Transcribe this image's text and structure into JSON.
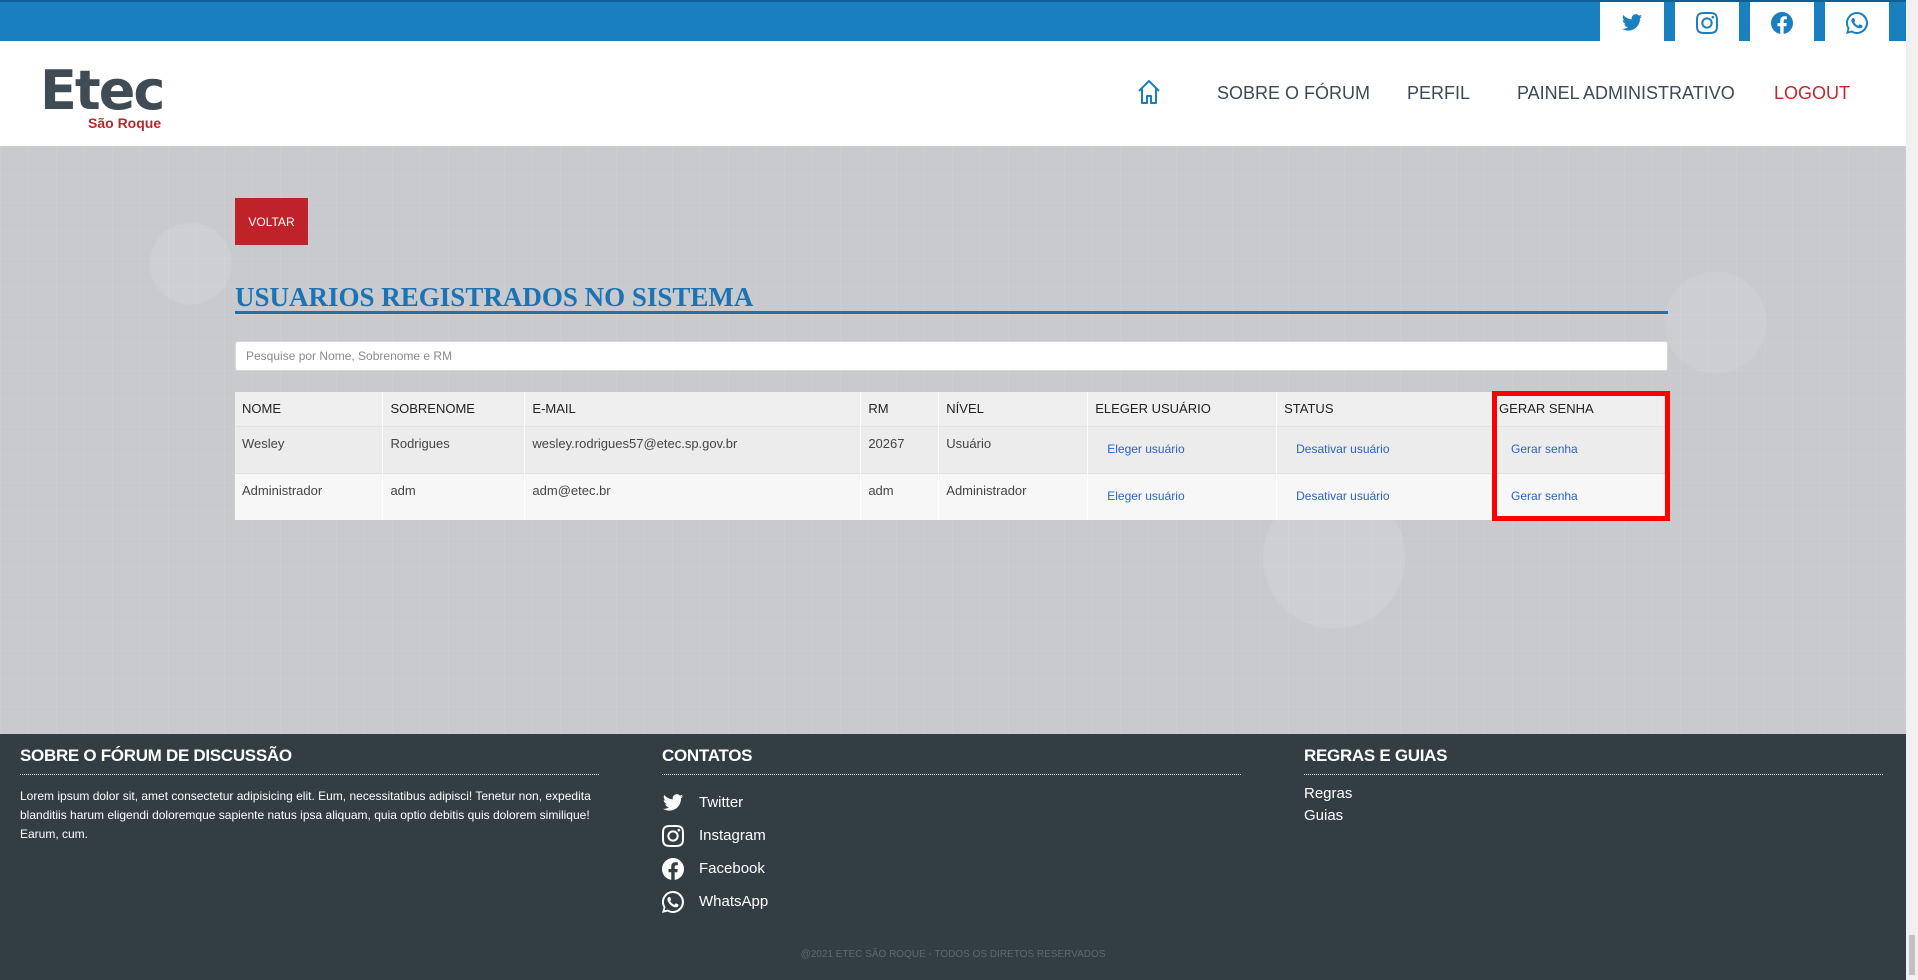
{
  "social": [
    {
      "name": "twitter-icon"
    },
    {
      "name": "instagram-icon"
    },
    {
      "name": "facebook-icon"
    },
    {
      "name": "whatsapp-icon"
    }
  ],
  "logo": {
    "main": "Etec",
    "sub": "São Roque"
  },
  "nav": {
    "home_icon": "home-icon",
    "items": [
      "SOBRE O FÓRUM",
      "PERFIL",
      "PAINEL ADMINISTRATIVO",
      "LOGOUT"
    ]
  },
  "main": {
    "back_button": "VOLTAR",
    "title": "USUARIOS REGISTRADOS NO SISTEMA",
    "search_placeholder": "Pesquise por Nome, Sobrenome e RM"
  },
  "table": {
    "headers": [
      "NOME",
      "SOBRENOME",
      "E-MAIL",
      "RM",
      "NÍVEL",
      "ELEGER USUÁRIO",
      "STATUS",
      "GERAR SENHA"
    ],
    "rows": [
      {
        "nome": "Wesley",
        "sobrenome": "Rodrigues",
        "email": "wesley.rodrigues57@etec.sp.gov.br",
        "rm": "20267",
        "nivel": "Usuário",
        "eleger": "Eleger usuário",
        "status": "Desativar usuário",
        "senha": "Gerar senha"
      },
      {
        "nome": "Administrador",
        "sobrenome": "adm",
        "email": "adm@etec.br",
        "rm": "adm",
        "nivel": "Administrador",
        "eleger": "Eleger usuário",
        "status": "Desativar usuário",
        "senha": "Gerar senha"
      }
    ]
  },
  "footer": {
    "about": {
      "title": "SOBRE O FÓRUM DE DISCUSSÃO",
      "text": "Lorem ipsum dolor sit, amet consectetur adipisicing elit. Eum, necessitatibus adipisci! Tenetur non, expedita blanditiis harum eligendi doloremque sapiente natus ipsa aliquam, quia optio debitis quis dolorem similique! Earum, cum."
    },
    "contacts": {
      "title": "CONTATOS",
      "items": [
        "Twitter",
        "Instagram",
        "Facebook",
        "WhatsApp"
      ]
    },
    "rules": {
      "title": "REGRAS E GUIAS",
      "items": [
        "Regras",
        "Guias"
      ]
    },
    "copyright": "@2021 ETEC SÃO ROQUE - TODOS OS DIRETOS RESERVADOS"
  },
  "colors": {
    "primary": "#1a7fbf",
    "accent": "#bf2329",
    "footer": "#323d44",
    "highlight": "#ff0000"
  }
}
